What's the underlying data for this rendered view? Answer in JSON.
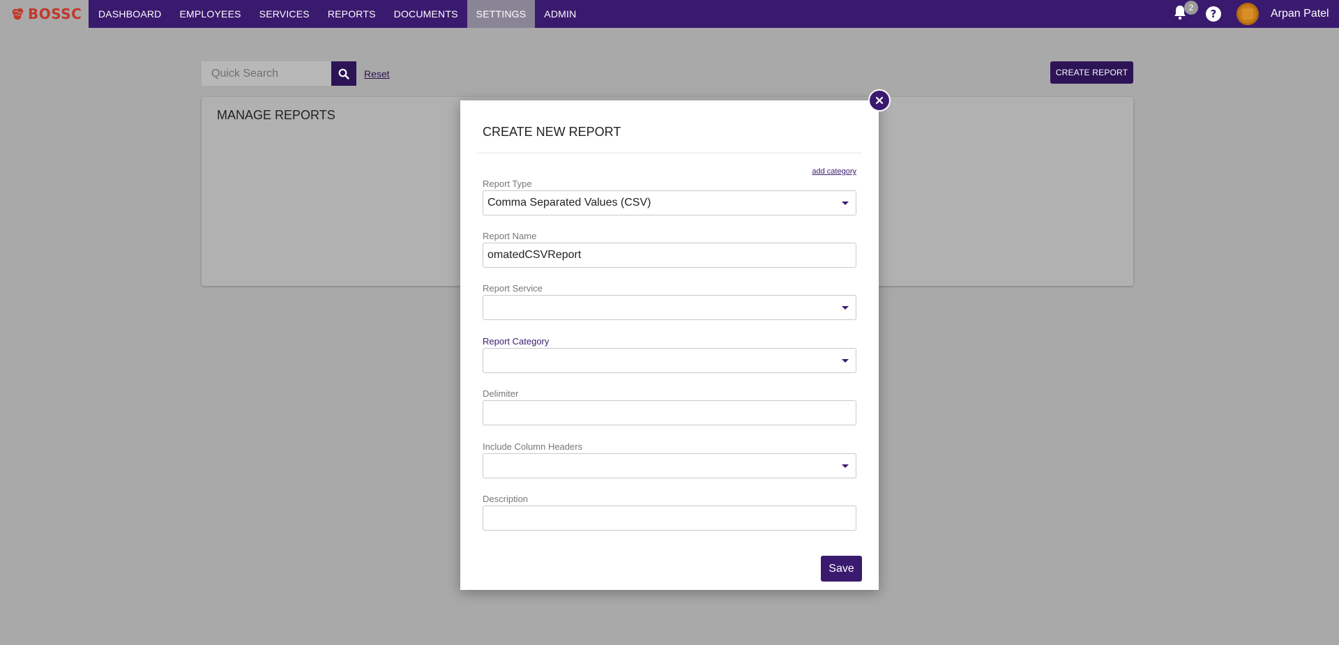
{
  "brand": {
    "name": "BOSSC",
    "color": "#c0392b"
  },
  "nav": {
    "items": [
      {
        "label": "DASHBOARD",
        "active": false
      },
      {
        "label": "EMPLOYEES",
        "active": false
      },
      {
        "label": "SERVICES",
        "active": false
      },
      {
        "label": "REPORTS",
        "active": false
      },
      {
        "label": "DOCUMENTS",
        "active": false
      },
      {
        "label": "SETTINGS",
        "active": true
      },
      {
        "label": "ADMIN",
        "active": false
      }
    ],
    "notifications_count": "2",
    "bell_icon": "bell-icon",
    "help_icon": "question-circle-icon",
    "user_name": "Arpan Patel"
  },
  "toolbar": {
    "search_placeholder": "Quick Search",
    "search_icon": "search-icon",
    "reset_label": "Reset",
    "create_report_label": "CREATE REPORT"
  },
  "panel": {
    "title": "MANAGE REPORTS"
  },
  "modal": {
    "title": "CREATE NEW REPORT",
    "add_category_label": "add category",
    "fields": {
      "report_type": {
        "label": "Report Type",
        "value": "Comma Separated Values (CSV)"
      },
      "report_name": {
        "label": "Report Name",
        "value": "omatedCSVReport"
      },
      "report_service": {
        "label": "Report Service",
        "value": ""
      },
      "report_category": {
        "label": "Report Category",
        "value": ""
      },
      "delimiter": {
        "label": "Delimiter",
        "value": ""
      },
      "include_column_headers": {
        "label": "Include Column Headers",
        "value": ""
      },
      "description": {
        "label": "Description",
        "value": ""
      }
    },
    "save_label": "Save",
    "close_icon": "close-icon"
  },
  "colors": {
    "primary": "#3a1a6e",
    "overlay": "#a9a9a9",
    "active_tab": "#8a8497"
  }
}
